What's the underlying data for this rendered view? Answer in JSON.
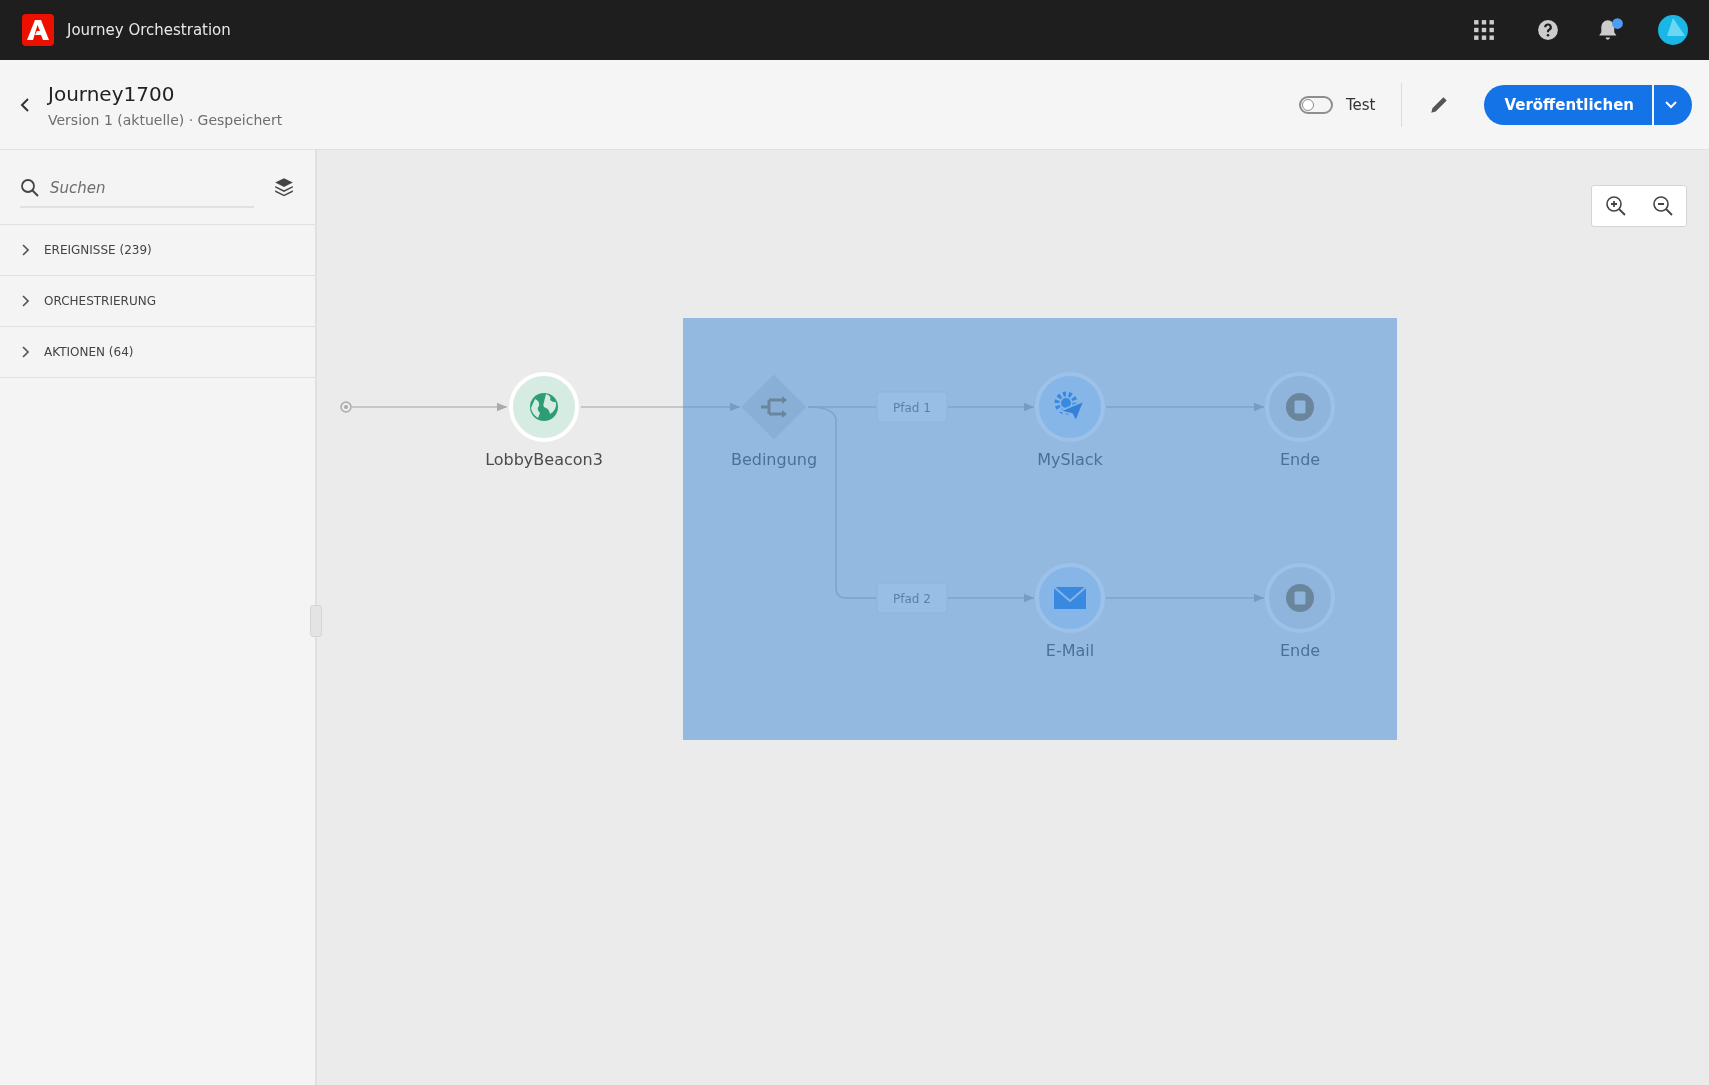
{
  "app": {
    "name": "Journey Orchestration",
    "notification_badge": true
  },
  "journey": {
    "title": "Journey1700",
    "subtitle": "Version 1 (aktuelle) · Gespeichert"
  },
  "test_toggle": {
    "label": "Test",
    "on": false
  },
  "publish_button": {
    "label": "Veröffentlichen"
  },
  "sidebar": {
    "search": {
      "placeholder": "Suchen"
    },
    "items": [
      {
        "label": "EREIGNISSE (239)",
        "expanded": false
      },
      {
        "label": "ORCHESTRIERUNG",
        "expanded": false
      },
      {
        "label": "AKTIONEN (64)",
        "expanded": false
      }
    ]
  },
  "canvas": {
    "selection_shown": true,
    "entry": {
      "kind": "event",
      "label": "LobbyBeacon3"
    },
    "condition": {
      "kind": "condition",
      "label": "Bedingung"
    },
    "paths": [
      {
        "label": "Pfad 1",
        "action": {
          "kind": "slack",
          "label": "MySlack"
        },
        "end": {
          "kind": "end",
          "label": "Ende"
        }
      },
      {
        "label": "Pfad 2",
        "action": {
          "kind": "email",
          "label": "E-Mail"
        },
        "end": {
          "kind": "end",
          "label": "Ende"
        }
      }
    ]
  }
}
